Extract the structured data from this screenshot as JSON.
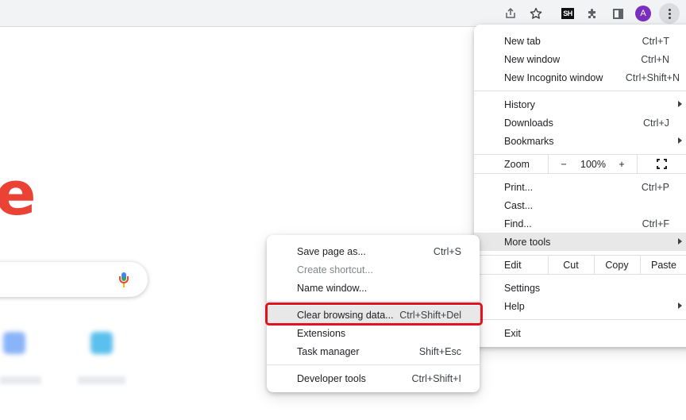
{
  "toolbar": {
    "icons": [
      "share-icon",
      "star-icon",
      "sh-extension-icon",
      "puzzle-icon",
      "side-panel-icon",
      "avatar",
      "kebab-menu-icon"
    ],
    "extension_badge": "SH",
    "avatar_initial": "A",
    "avatar_color": "#7b2fbf"
  },
  "ntp": {
    "logo_fragment": "e",
    "logo_color": "#ea4335"
  },
  "main_menu": {
    "new_tab": {
      "label": "New tab",
      "shortcut": "Ctrl+T"
    },
    "new_window": {
      "label": "New window",
      "shortcut": "Ctrl+N"
    },
    "new_incognito": {
      "label": "New Incognito window",
      "shortcut": "Ctrl+Shift+N"
    },
    "history": {
      "label": "History"
    },
    "downloads": {
      "label": "Downloads",
      "shortcut": "Ctrl+J"
    },
    "bookmarks": {
      "label": "Bookmarks"
    },
    "zoom": {
      "label": "Zoom",
      "minus": "−",
      "value": "100%",
      "plus": "+"
    },
    "print": {
      "label": "Print...",
      "shortcut": "Ctrl+P"
    },
    "cast": {
      "label": "Cast..."
    },
    "find": {
      "label": "Find...",
      "shortcut": "Ctrl+F"
    },
    "more_tools": {
      "label": "More tools"
    },
    "edit": {
      "label": "Edit",
      "cut": "Cut",
      "copy": "Copy",
      "paste": "Paste"
    },
    "settings": {
      "label": "Settings"
    },
    "help": {
      "label": "Help"
    },
    "exit": {
      "label": "Exit"
    }
  },
  "more_tools_menu": {
    "save_page": {
      "label": "Save page as...",
      "shortcut": "Ctrl+S"
    },
    "create_shortcut": {
      "label": "Create shortcut..."
    },
    "name_window": {
      "label": "Name window..."
    },
    "clear_browsing": {
      "label": "Clear browsing data...",
      "shortcut": "Ctrl+Shift+Del"
    },
    "extensions": {
      "label": "Extensions"
    },
    "task_manager": {
      "label": "Task manager",
      "shortcut": "Shift+Esc"
    },
    "developer_tools": {
      "label": "Developer tools",
      "shortcut": "Ctrl+Shift+I"
    }
  },
  "annotation": {
    "highlight_color": "#e0141e"
  }
}
